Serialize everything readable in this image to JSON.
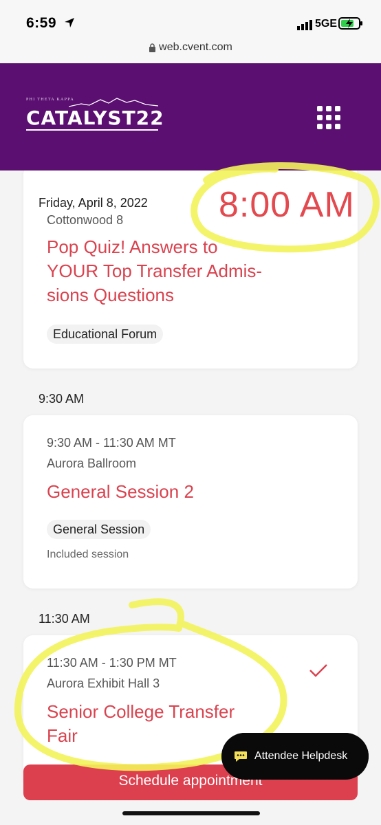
{
  "status_bar": {
    "time": "6:59",
    "network": "5GE"
  },
  "browser": {
    "url": "web.cvent.com"
  },
  "header": {
    "logo_small": "PHI THETA KAPPA",
    "logo_main": "CATALYST22",
    "menu_icon": "grid-menu-icon"
  },
  "schedule": {
    "date": "Friday, April 8, 2022",
    "annotation_time": "8:00 AM",
    "sessions": [
      {
        "room": "Cottonwood 8",
        "title": "Pop Quiz! Answers to YOUR Top Transfer Admis-sions Questions",
        "title_lines": [
          "Pop Quiz! Answers to",
          "YOUR Top Transfer Admis-",
          "sions Questions"
        ],
        "tag": "Educational Forum"
      },
      {
        "time_header": "9:30 AM",
        "time_range": "9:30 AM - 11:30 AM MT",
        "room": "Aurora Ballroom",
        "title": "General Session 2",
        "tag": "General Session",
        "note": "Included session"
      },
      {
        "time_header": "11:30 AM",
        "time_range": "11:30 AM - 1:30 PM MT",
        "room": "Aurora Exhibit Hall 3",
        "title_lines": [
          "Senior College Transfer",
          "Fair"
        ],
        "selected": true
      }
    ]
  },
  "helpdesk": {
    "label": "Attendee Helpdesk"
  },
  "schedule_button": {
    "label": "Schedule appointment"
  },
  "colors": {
    "brand_purple": "#5b0f71",
    "accent_red": "#d9434f",
    "highlighter": "#f3f35a"
  }
}
